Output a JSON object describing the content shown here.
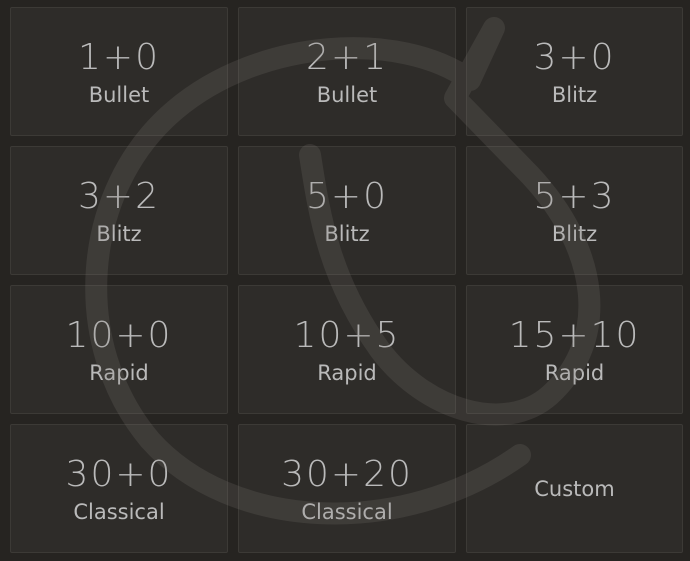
{
  "pools": [
    {
      "time": "1+0",
      "perf": "Bullet"
    },
    {
      "time": "2+1",
      "perf": "Bullet"
    },
    {
      "time": "3+0",
      "perf": "Blitz"
    },
    {
      "time": "3+2",
      "perf": "Blitz"
    },
    {
      "time": "5+0",
      "perf": "Blitz"
    },
    {
      "time": "5+3",
      "perf": "Blitz"
    },
    {
      "time": "10+0",
      "perf": "Rapid"
    },
    {
      "time": "10+5",
      "perf": "Rapid"
    },
    {
      "time": "15+10",
      "perf": "Rapid"
    },
    {
      "time": "30+0",
      "perf": "Classical"
    },
    {
      "time": "30+20",
      "perf": "Classical"
    }
  ],
  "custom_label": "Custom",
  "colors": {
    "background": "#262421",
    "tile": "#2e2c29",
    "tile_border": "#3c3a36",
    "text": "#bababa"
  }
}
